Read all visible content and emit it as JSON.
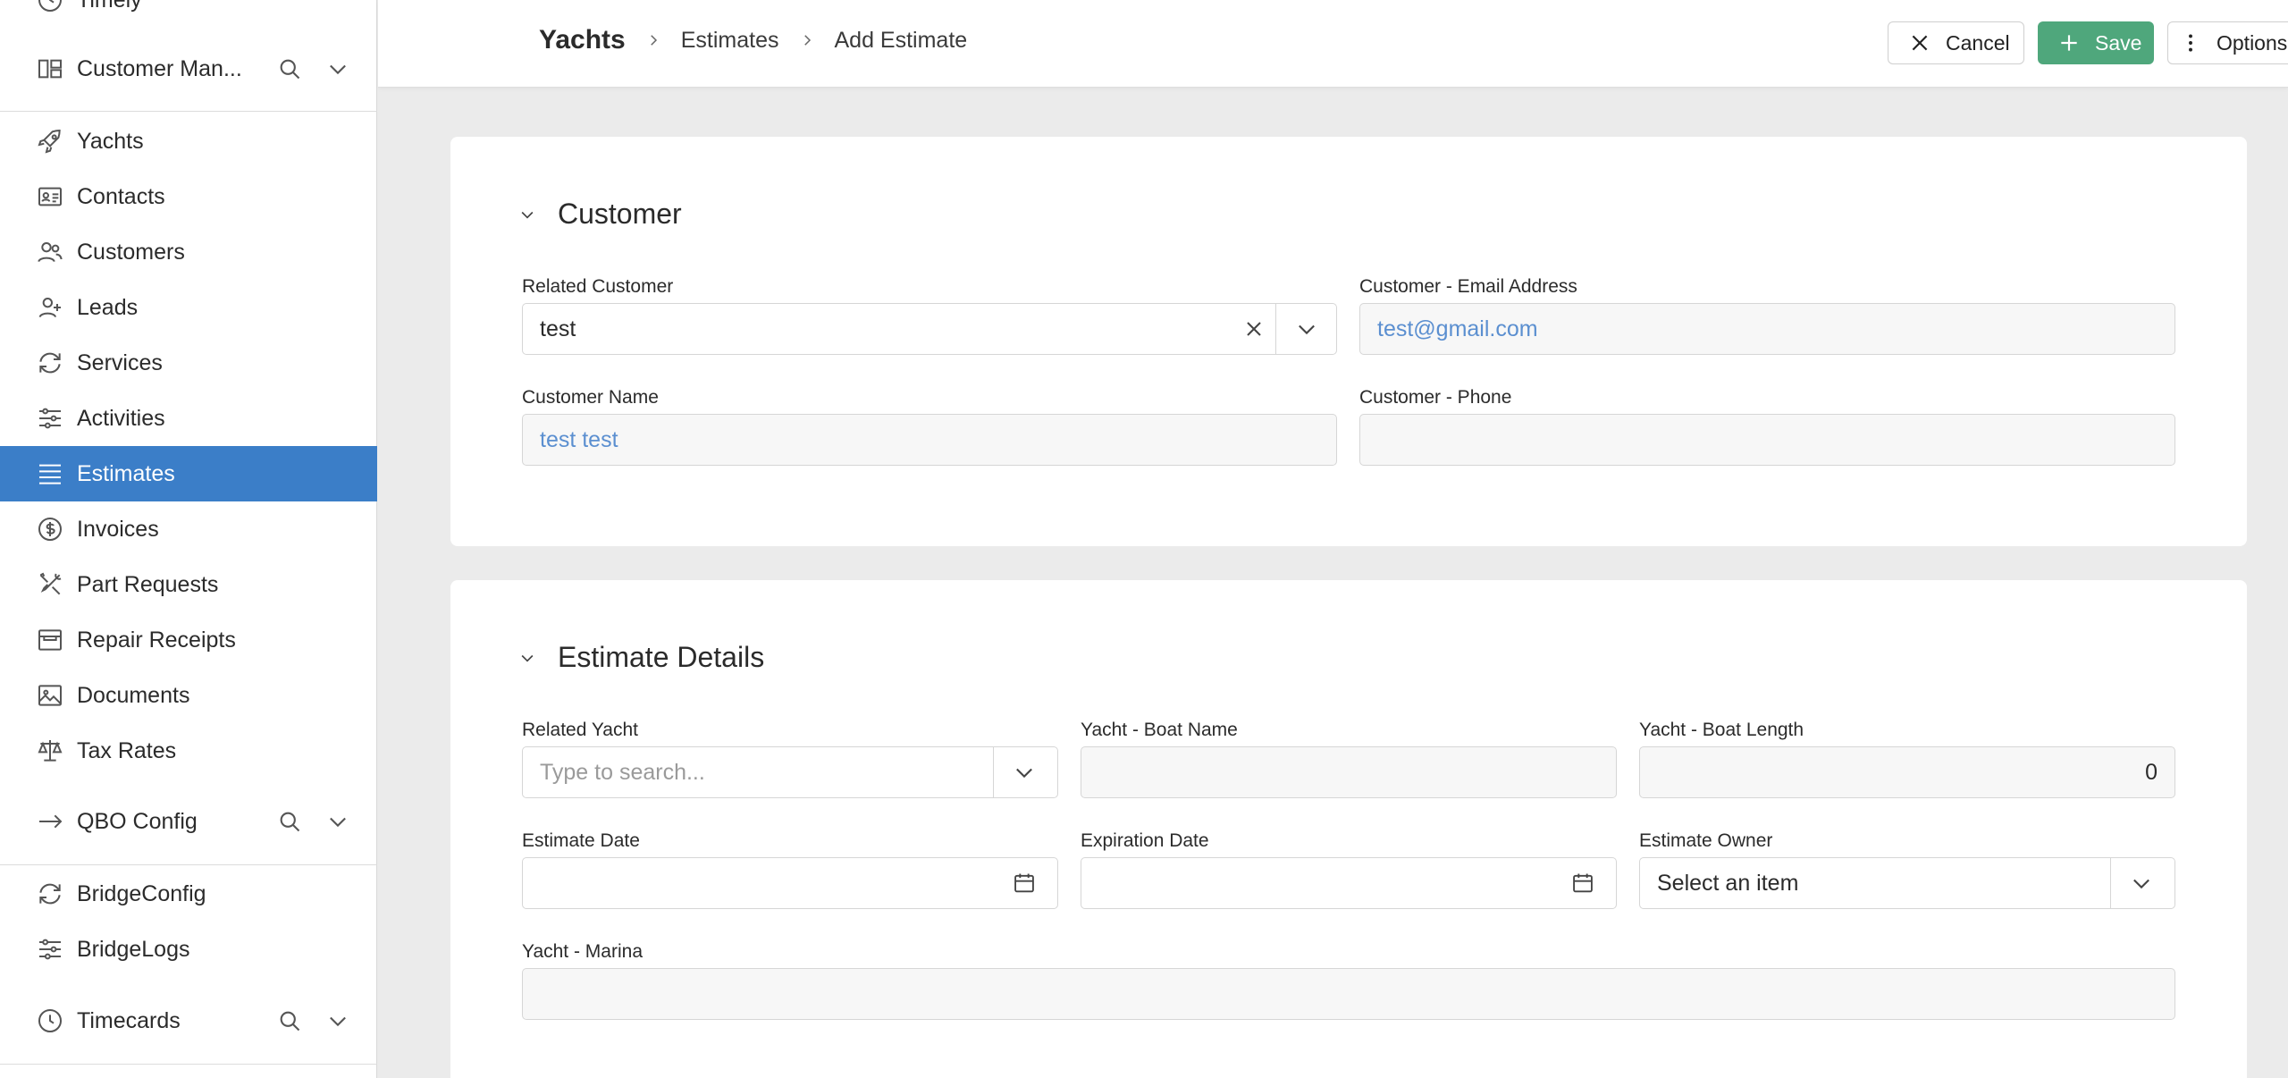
{
  "sidebar": {
    "top_partial_label": "Timely",
    "groups": {
      "customer": {
        "label": "Customer Man..."
      },
      "qbo": {
        "label": "QBO Config"
      },
      "timecards": {
        "label": "Timecards"
      }
    },
    "items": {
      "yachts": "Yachts",
      "contacts": "Contacts",
      "customers": "Customers",
      "leads": "Leads",
      "services": "Services",
      "activities": "Activities",
      "estimates": "Estimates",
      "invoices": "Invoices",
      "part_requests": "Part Requests",
      "repair_receipts": "Repair Receipts",
      "documents": "Documents",
      "tax_rates": "Tax Rates",
      "bridge_config": "BridgeConfig",
      "bridge_logs": "BridgeLogs"
    },
    "active_item": "Estimates"
  },
  "header": {
    "breadcrumb": {
      "root": "Yachts",
      "level1": "Estimates",
      "level2": "Add Estimate"
    },
    "cancel_label": "Cancel",
    "save_label": "Save",
    "options_label": "Options"
  },
  "customer_section": {
    "title": "Customer",
    "related_customer": {
      "label": "Related Customer",
      "value": "test"
    },
    "email": {
      "label": "Customer - Email Address",
      "value": "test@gmail.com"
    },
    "name": {
      "label": "Customer Name",
      "value": "test test"
    },
    "phone": {
      "label": "Customer - Phone",
      "value": ""
    }
  },
  "estimate_section": {
    "title": "Estimate Details",
    "related_yacht": {
      "label": "Related Yacht",
      "placeholder": "Type to search..."
    },
    "boat_name": {
      "label": "Yacht - Boat Name",
      "value": ""
    },
    "boat_length": {
      "label": "Yacht - Boat Length",
      "value": "0"
    },
    "estimate_date": {
      "label": "Estimate Date",
      "value": ""
    },
    "expiration_date": {
      "label": "Expiration Date",
      "value": ""
    },
    "estimate_owner": {
      "label": "Estimate Owner",
      "value": "Select an item"
    },
    "marina": {
      "label": "Yacht - Marina",
      "value": ""
    }
  },
  "colors": {
    "accent_active": "#3b7ec8",
    "save_button": "#4fa77c",
    "link_value": "#5b8fd0",
    "page_background": "#ebebeb"
  },
  "icons": [
    "clock-icon",
    "dashboard-icon",
    "search-icon",
    "chevron-down-icon",
    "rocket-icon",
    "contact-card-icon",
    "users-icon",
    "user-plus-icon",
    "refresh-icon",
    "sliders-icon",
    "list-icon",
    "dollar-circle-icon",
    "tools-icon",
    "receipt-box-icon",
    "image-icon",
    "scale-icon",
    "arrow-right-icon",
    "close-icon",
    "plus-icon",
    "more-vertical-icon",
    "calendar-icon"
  ]
}
